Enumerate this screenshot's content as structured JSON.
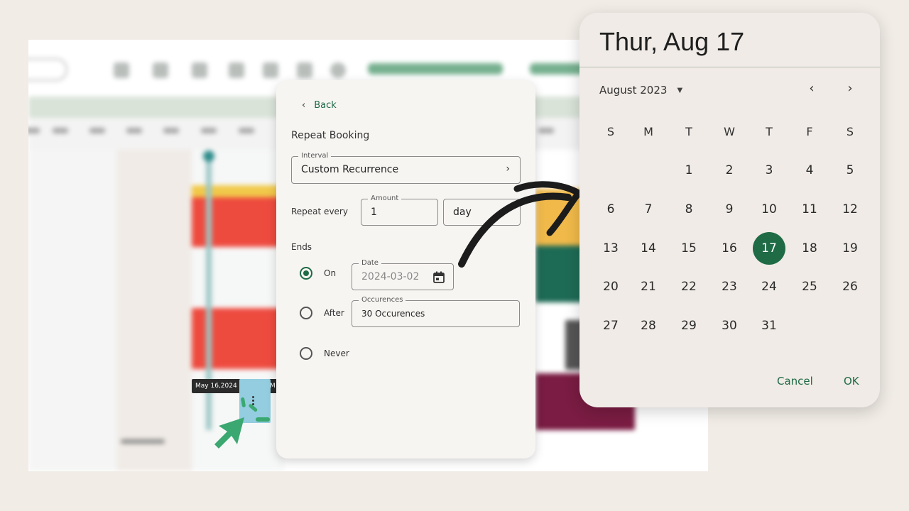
{
  "background_app": {
    "tooltip_date": "May 16,2024",
    "tooltip_partial": "M"
  },
  "repeat_panel": {
    "back_label": "Back",
    "title": "Repeat Booking",
    "interval": {
      "legend": "Interval",
      "value": "Custom Recurrence"
    },
    "repeat_every_label": "Repeat every",
    "amount": {
      "legend": "Amount",
      "value": "1"
    },
    "unit": {
      "value": "day"
    },
    "ends_label": "Ends",
    "options": {
      "on_label": "On",
      "after_label": "After",
      "never_label": "Never",
      "selected": "On"
    },
    "date": {
      "legend": "Date",
      "value": "2024-03-02"
    },
    "occurrences": {
      "legend": "Occurences",
      "value": "30 Occurences"
    }
  },
  "date_picker": {
    "header": "Thur, Aug 17",
    "month_label": "August 2023",
    "weekdays": [
      "S",
      "M",
      "T",
      "W",
      "T",
      "F",
      "S"
    ],
    "first_weekday_index": 2,
    "days_in_month": 31,
    "selected_day": 17,
    "cancel_label": "Cancel",
    "ok_label": "OK"
  },
  "colors": {
    "accent": "#1f6b46",
    "page_bg": "#f1ece6",
    "panel_bg": "#f7f5f2",
    "picker_bg": "#f0ebe6"
  }
}
